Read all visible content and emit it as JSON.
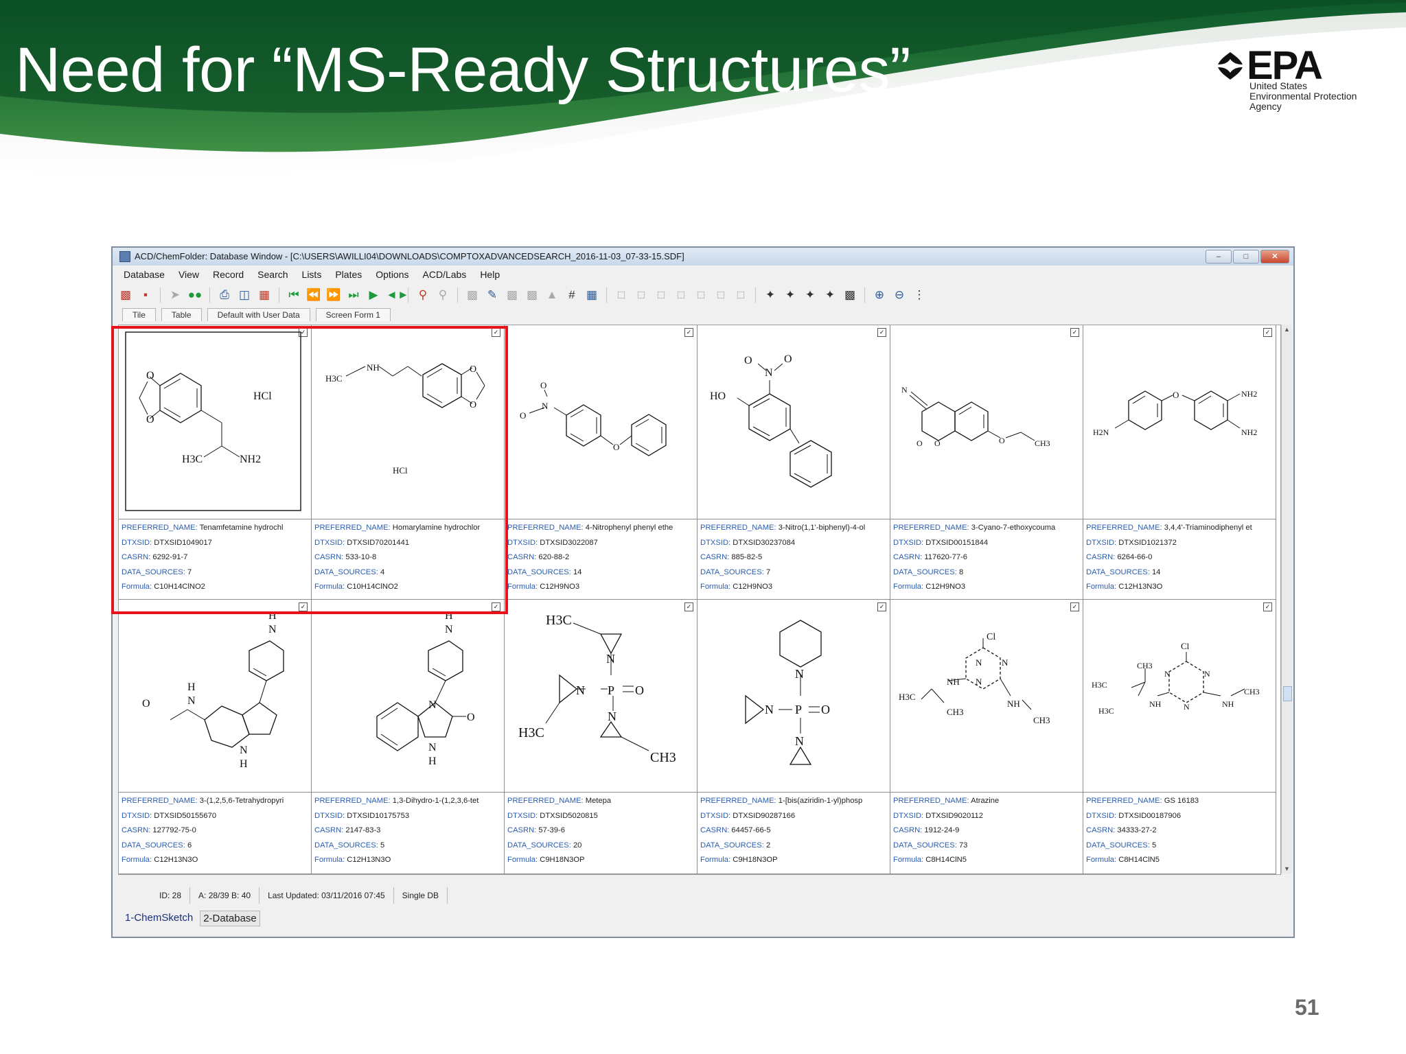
{
  "slide": {
    "title": "Need for “MS-Ready Structures”",
    "page_number": "51",
    "logo": {
      "name": "EPA",
      "subtitle": [
        "United States",
        "Environmental Protection",
        "Agency"
      ]
    }
  },
  "window": {
    "title": "ACD/ChemFolder: Database Window - [C:\\USERS\\AWILLI04\\DOWNLOADS\\COMPTOXADVANCEDSEARCH_2016-11-03_07-33-15.SDF]",
    "menu": [
      "Database",
      "View",
      "Record",
      "Search",
      "Lists",
      "Plates",
      "Options",
      "ACD/Labs",
      "Help"
    ],
    "tabs": [
      "Tile",
      "Table",
      "Default with User Data",
      "Screen Form 1"
    ],
    "labels": {
      "preferred_name": "PREFERRED_NAME:",
      "dtxsid": "DTXSID:",
      "casrn": "CASRN:",
      "data_sources": "DATA_SOURCES:",
      "formula": "Formula:"
    },
    "records": [
      {
        "preferred_name": "Tenamfetamine hydrochl",
        "dtxsid": "DTXSID1049017",
        "casrn": "6292-91-7",
        "data_sources": "7",
        "formula": "C10H14ClNO2",
        "structure_text": [
          "O",
          "O",
          "HCl",
          "H3C",
          "NH2"
        ]
      },
      {
        "preferred_name": "Homarylamine hydrochlor",
        "dtxsid": "DTXSID70201441",
        "casrn": "533-10-8",
        "data_sources": "4",
        "formula": "C10H14ClNO2",
        "structure_text": [
          "H3C",
          "NH",
          "O",
          "O",
          "HCl"
        ]
      },
      {
        "preferred_name": "4-Nitrophenyl phenyl ethe",
        "dtxsid": "DTXSID3022087",
        "casrn": "620-88-2",
        "data_sources": "14",
        "formula": "C12H9NO3",
        "structure_text": [
          "O",
          "N",
          "O",
          "O"
        ]
      },
      {
        "preferred_name": "3-Nitro(1,1'-biphenyl)-4-ol",
        "dtxsid": "DTXSID30237084",
        "casrn": "885-82-5",
        "data_sources": "7",
        "formula": "C12H9NO3",
        "structure_text": [
          "O",
          "N",
          "O",
          "HO"
        ]
      },
      {
        "preferred_name": "3-Cyano-7-ethoxycouma",
        "dtxsid": "DTXSID00151844",
        "casrn": "117620-77-6",
        "data_sources": "8",
        "formula": "C12H9NO3",
        "structure_text": [
          "N",
          "O",
          "O",
          "O",
          "CH3"
        ]
      },
      {
        "preferred_name": "3,4,4'-Triaminodiphenyl et",
        "dtxsid": "DTXSID1021372",
        "casrn": "6264-66-0",
        "data_sources": "14",
        "formula": "C12H13N3O",
        "structure_text": [
          "H2N",
          "O",
          "NH2",
          "NH2"
        ]
      },
      {
        "preferred_name": "3-(1,2,5,6-Tetrahydropyri",
        "dtxsid": "DTXSID50155670",
        "casrn": "127792-75-0",
        "data_sources": "6",
        "formula": "C12H13N3O",
        "structure_text": [
          "H",
          "N",
          "H",
          "O",
          "N",
          "N",
          "H"
        ]
      },
      {
        "preferred_name": "1,3-Dihydro-1-(1,2,3,6-tet",
        "dtxsid": "DTXSID10175753",
        "casrn": "2147-83-3",
        "data_sources": "5",
        "formula": "C12H13N3O",
        "structure_text": [
          "H",
          "N",
          "N",
          "O",
          "N",
          "H"
        ]
      },
      {
        "preferred_name": "Metepa",
        "dtxsid": "DTXSID5020815",
        "casrn": "57-39-6",
        "data_sources": "20",
        "formula": "C9H18N3OP",
        "structure_text": [
          "H3C",
          "N",
          "N",
          "P",
          "O",
          "N",
          "H3C",
          "CH3"
        ]
      },
      {
        "preferred_name": "1-[bis(aziridin-1-yl)phosp",
        "dtxsid": "DTXSID90287166",
        "casrn": "64457-66-5",
        "data_sources": "2",
        "formula": "C9H18N3OP",
        "structure_text": [
          "N",
          "N",
          "P",
          "O",
          "N"
        ]
      },
      {
        "preferred_name": "Atrazine",
        "dtxsid": "DTXSID9020112",
        "casrn": "1912-24-9",
        "data_sources": "73",
        "formula": "C8H14ClN5",
        "structure_text": [
          "Cl",
          "N",
          "N",
          "N",
          "NH",
          "H3C",
          "CH3",
          "NH",
          "CH3"
        ]
      },
      {
        "preferred_name": "GS 16183",
        "dtxsid": "DTXSID00187906",
        "casrn": "34333-27-2",
        "data_sources": "5",
        "formula": "C8H14ClN5",
        "structure_text": [
          "Cl",
          "N",
          "N",
          "N",
          "CH3",
          "H3C",
          "H3C",
          "NH",
          "NH",
          "CH3"
        ]
      }
    ],
    "status": [
      "ID: 28",
      "A: 28/39   B: 40",
      "Last Updated: 03/11/2016 07:45",
      "Single DB"
    ],
    "bottom_tabs": [
      "1-ChemSketch",
      "2-Database"
    ]
  },
  "colors": {
    "banner_green": "#1a6b34",
    "field_label": "#2a5db0",
    "highlight": "#e8121c"
  },
  "icons": [
    "open-db-icon",
    "close-db-icon",
    "record-add-icon",
    "go-green-icon",
    "print-icon",
    "save-icon",
    "export-icon",
    "first-record-icon",
    "prev-record-icon",
    "next-record-icon",
    "last-record-icon",
    "go-to-icon",
    "search-icon",
    "hash-icon",
    "grid-icon",
    "zoom-in-icon",
    "zoom-out-icon"
  ]
}
